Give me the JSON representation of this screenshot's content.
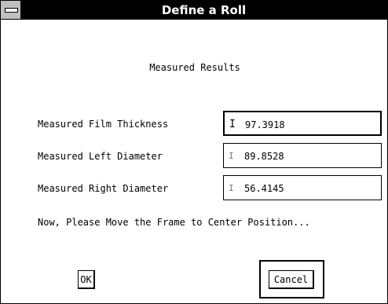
{
  "window": {
    "title": "Define a Roll"
  },
  "dialog": {
    "heading": "Measured Results",
    "fields": [
      {
        "label": "Measured Film Thickness",
        "value": "97.3918"
      },
      {
        "label": "Measured Left Diameter",
        "value": "89.8528"
      },
      {
        "label": "Measured Right Diameter",
        "value": "56.4145"
      }
    ],
    "message": "Now, Please Move the Frame to Center Position..."
  },
  "buttons": {
    "ok_label": "OK",
    "cancel_label": "Cancel"
  },
  "icons": {
    "system_menu": "system-menu-icon",
    "text_cursor": "text-cursor-icon"
  },
  "colors": {
    "title_bar": "#000000",
    "title_text": "#ffffff",
    "system_menu_button": "#c0c0c0",
    "background": "#ffffff"
  }
}
